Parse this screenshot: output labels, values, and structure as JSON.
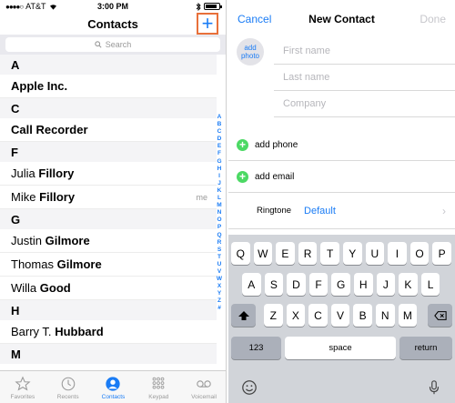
{
  "left": {
    "status": {
      "carrier": "AT&T",
      "time": "3:00 PM",
      "battery_level": 0.7
    },
    "nav_title": "Contacts",
    "add_symbol": "+",
    "search_placeholder": "Search",
    "list": [
      {
        "type": "section",
        "label": "A"
      },
      {
        "type": "row",
        "first": "",
        "last": "Apple Inc."
      },
      {
        "type": "section",
        "label": "C"
      },
      {
        "type": "row",
        "first": "",
        "last": "Call Recorder"
      },
      {
        "type": "section",
        "label": "F"
      },
      {
        "type": "row",
        "first": "Julia",
        "last": "Fillory"
      },
      {
        "type": "row",
        "first": "Mike",
        "last": "Fillory",
        "badge": "me"
      },
      {
        "type": "section",
        "label": "G"
      },
      {
        "type": "row",
        "first": "Justin",
        "last": "Gilmore"
      },
      {
        "type": "row",
        "first": "Thomas",
        "last": "Gilmore"
      },
      {
        "type": "row",
        "first": "Willa",
        "last": "Good"
      },
      {
        "type": "section",
        "label": "H"
      },
      {
        "type": "row",
        "first": "Barry T.",
        "last": "Hubbard"
      },
      {
        "type": "section",
        "label": "M"
      }
    ],
    "index_letters": [
      "A",
      "B",
      "C",
      "D",
      "E",
      "F",
      "G",
      "H",
      "I",
      "J",
      "K",
      "L",
      "M",
      "N",
      "O",
      "P",
      "Q",
      "R",
      "S",
      "T",
      "U",
      "V",
      "W",
      "X",
      "Y",
      "Z",
      "#"
    ],
    "tabs": [
      {
        "label": "Favorites",
        "icon": "star-icon",
        "active": false
      },
      {
        "label": "Recents",
        "icon": "clock-icon",
        "active": false
      },
      {
        "label": "Contacts",
        "icon": "person-icon",
        "active": true
      },
      {
        "label": "Keypad",
        "icon": "keypad-icon",
        "active": false
      },
      {
        "label": "Voicemail",
        "icon": "voicemail-icon",
        "active": false
      }
    ]
  },
  "right": {
    "nav": {
      "cancel": "Cancel",
      "title": "New Contact",
      "done": "Done"
    },
    "photo": {
      "line1": "add",
      "line2": "photo"
    },
    "fields": [
      {
        "placeholder": "First name"
      },
      {
        "placeholder": "Last name"
      },
      {
        "placeholder": "Company"
      }
    ],
    "add_phone": "add phone",
    "add_email": "add email",
    "ringtone_label": "Ringtone",
    "ringtone_value": "Default",
    "keyboard": {
      "row1": [
        "Q",
        "W",
        "E",
        "R",
        "T",
        "Y",
        "U",
        "I",
        "O",
        "P"
      ],
      "row2": [
        "A",
        "S",
        "D",
        "F",
        "G",
        "H",
        "J",
        "K",
        "L"
      ],
      "row3": [
        "Z",
        "X",
        "C",
        "V",
        "B",
        "N",
        "M"
      ],
      "numbers": "123",
      "space": "space",
      "return": "return"
    }
  },
  "colors": {
    "accent": "#1a7cf5",
    "add_highlight": "#e8703a",
    "green": "#4cd964"
  }
}
